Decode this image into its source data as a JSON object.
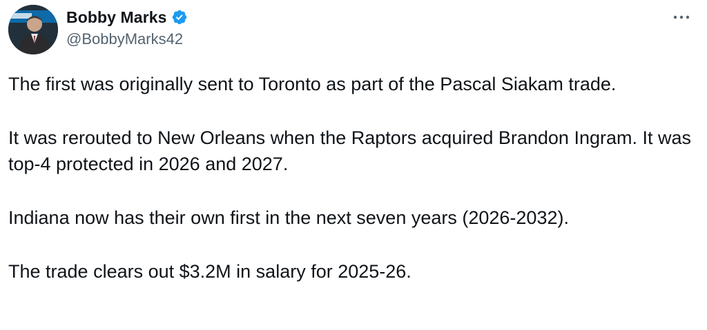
{
  "author": {
    "display_name": "Bobby Marks",
    "handle": "@BobbyMarks42",
    "avatar_icon": "profile-photo",
    "verified_icon": "verified-badge-icon",
    "verified_color": "#1d9bf0"
  },
  "menu": {
    "icon": "more-options-icon"
  },
  "tweet": {
    "paragraphs": [
      "The first was originally sent to Toronto as part of the Pascal Siakam trade.",
      "It was rerouted to New Orleans when the Raptors acquired Brandon Ingram. It was top-4 protected in 2026 and 2027.",
      "Indiana now has their own first in the next seven years (2026-2032).",
      "The trade clears out $3.2M in salary for 2025-26."
    ]
  }
}
